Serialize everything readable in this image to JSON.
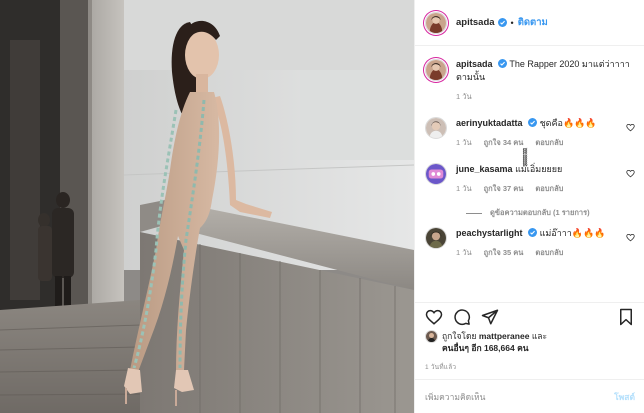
{
  "post": {
    "author": "apitsada",
    "follow_label": "ติดตาม",
    "dot": "•"
  },
  "caption": {
    "username": "apitsada",
    "text": "The Rapper 2020 มาแต่ว่าาาา ตามนั้น",
    "age": "1 วัน"
  },
  "comments": [
    {
      "username": "aerinyuktadatta",
      "text": "ชุดคือ🔥🔥🔥",
      "age": "1 วัน",
      "likes": "ถูกใจ 34 คน",
      "reply": "ตอบกลับ",
      "avatar_color": "#5a4a42"
    },
    {
      "username": "june_kasama",
      "text": "แม๊๊๊๊๊๊๊๊๊เอิ่มยยยย",
      "age": "1 วัน",
      "likes": "ถูกใจ 37 คน",
      "reply": "ตอบกลับ",
      "avatar_color": "#6b57c9"
    },
    {
      "username": "peachystarlight",
      "text": "แม่อ๊าาา🔥🔥🔥",
      "age": "1 วัน",
      "likes": "ถูกใจ 35 คน",
      "reply": "ตอบกลับ",
      "avatar_color": "#3f3a2c"
    }
  ],
  "view_replies": "ดูข้อความตอบกลับ (1 รายการ)",
  "actions": {
    "icons": [
      "heart-icon",
      "comment-icon",
      "share-icon",
      "bookmark-icon"
    ]
  },
  "likes": {
    "prefix": "ถูกใจโดย",
    "user": "mattperanee",
    "and": "และ",
    "others_label": "คนอื่นๆ อีก",
    "count": "168,664",
    "unit": "คน"
  },
  "timestamp": "1 วันที่แล้ว",
  "add_comment": {
    "placeholder": "เพิ่มความคิดเห็น",
    "post_label": "โพสต์"
  },
  "colors": {
    "link_blue": "#3897f0",
    "muted": "#8e8e8e",
    "verified": "#3897f0",
    "post_disabled": "#b2dffc"
  }
}
